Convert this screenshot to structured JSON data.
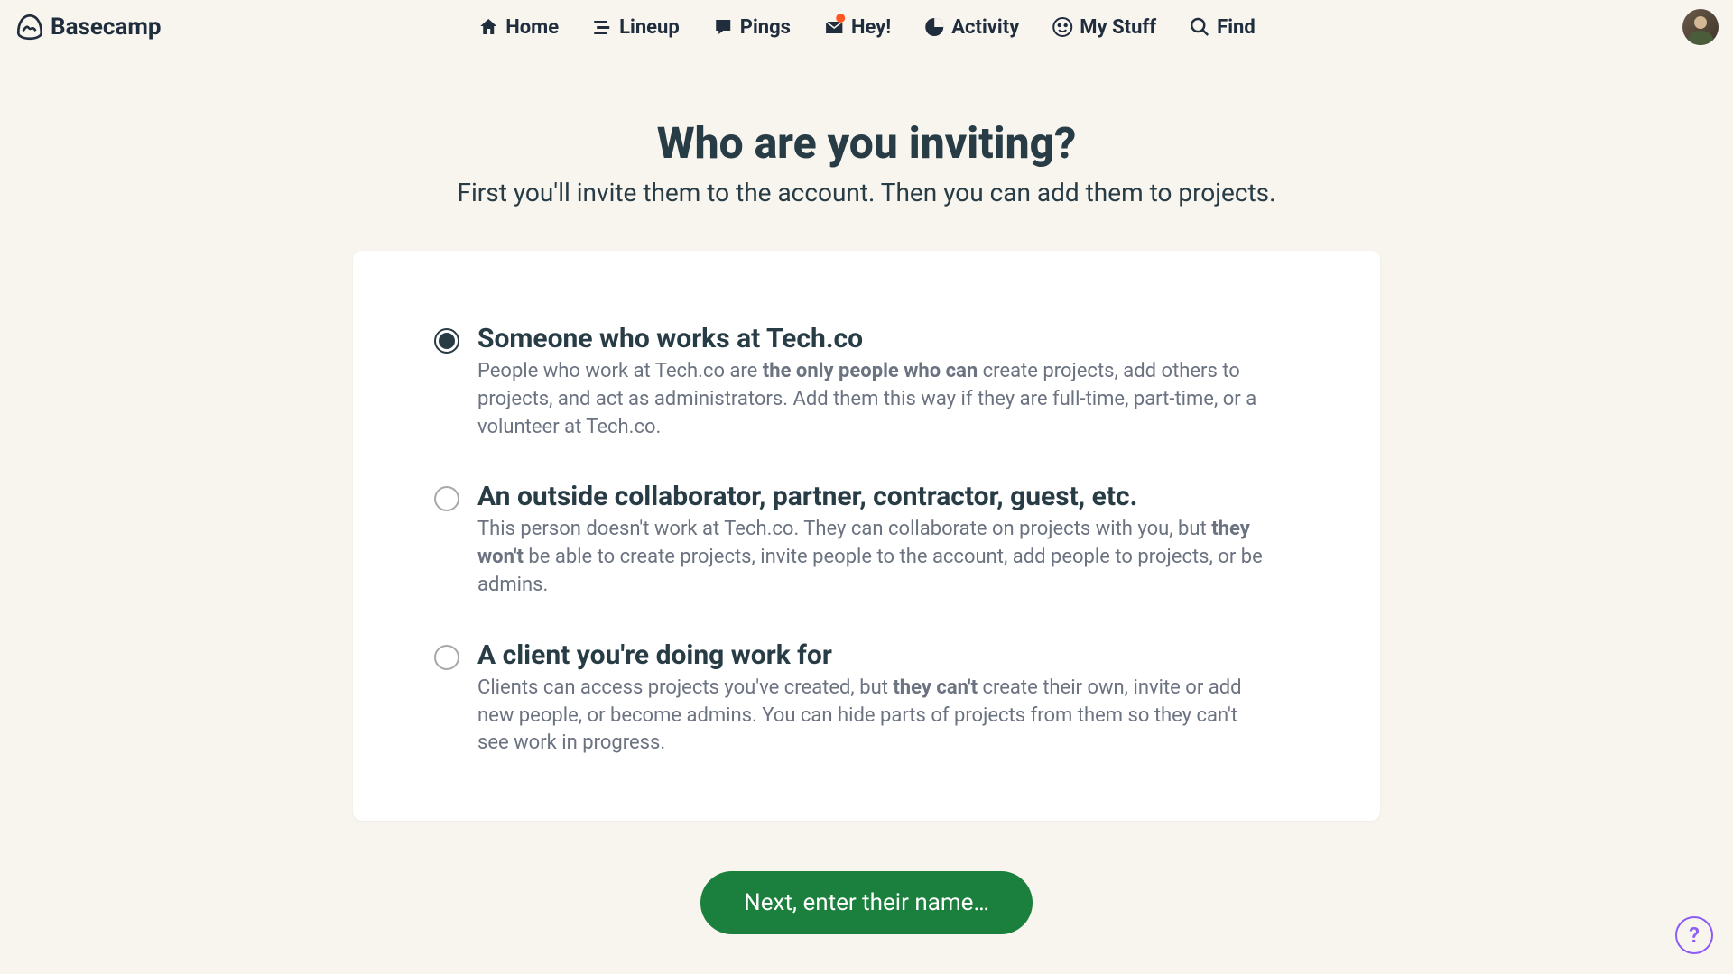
{
  "logo_text": "Basecamp",
  "nav": {
    "home": "Home",
    "lineup": "Lineup",
    "pings": "Pings",
    "hey": "Hey!",
    "activity": "Activity",
    "mystuff": "My Stuff",
    "find": "Find"
  },
  "page": {
    "title": "Who are you inviting?",
    "subtitle": "First you'll invite them to the account. Then you can add them to projects."
  },
  "options": [
    {
      "title": "Someone who works at Tech.co",
      "desc_pre": "People who work at Tech.co are ",
      "desc_bold": "the only people who can",
      "desc_post": " create projects, add others to projects, and act as administrators. Add them this way if they are full-time, part-time, or a volunteer at Tech.co.",
      "selected": true
    },
    {
      "title": "An outside collaborator, partner, contractor, guest, etc.",
      "desc_pre": "This person doesn't work at Tech.co. They can collaborate on projects with you, but ",
      "desc_bold": "they won't",
      "desc_post": " be able to create projects, invite people to the account, add people to projects, or be admins.",
      "selected": false
    },
    {
      "title": "A client you're doing work for",
      "desc_pre": "Clients can access projects you've created, but ",
      "desc_bold": "they can't",
      "desc_post": " create their own, invite or add new people, or become admins. You can hide parts of projects from them so they can't see work in progress.",
      "selected": false
    }
  ],
  "next_button": "Next, enter their name…",
  "help_label": "?"
}
